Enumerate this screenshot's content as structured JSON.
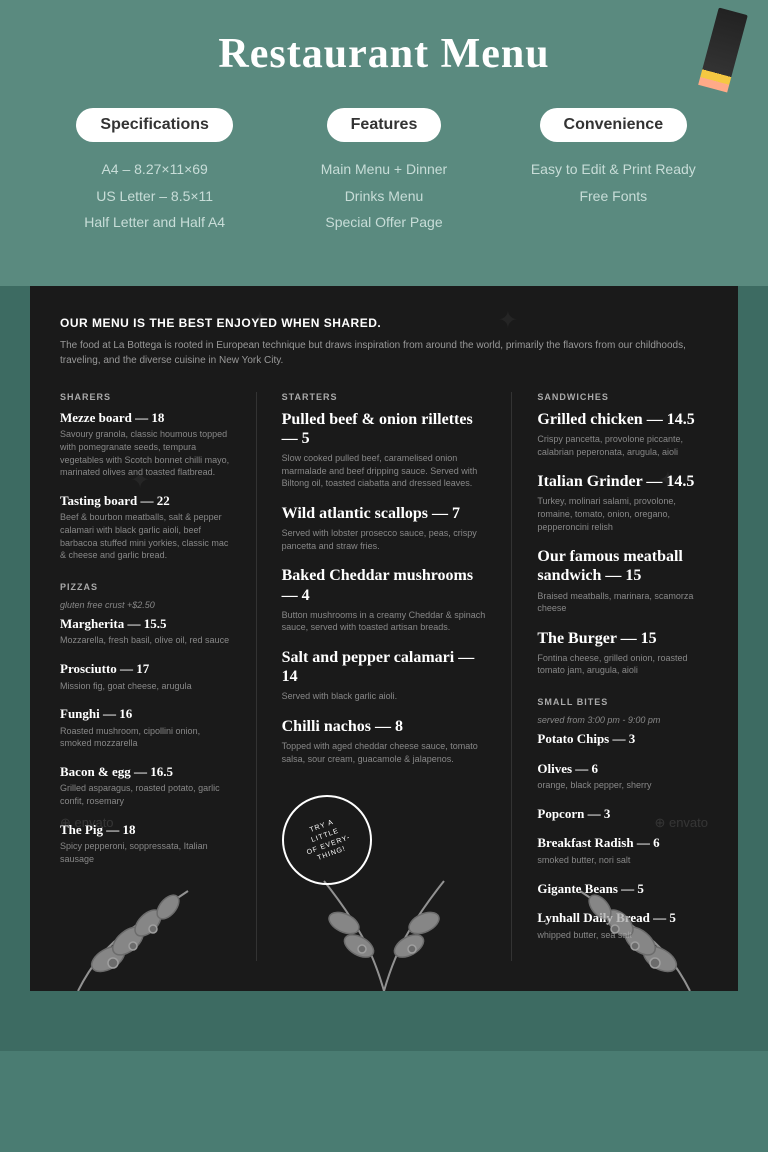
{
  "header": {
    "title": "Restaurant Menu"
  },
  "top": {
    "brown_strip_color": "#8B5E3C"
  },
  "specifications": {
    "label": "Specifications",
    "items": [
      "A4 – 8.27×11×69",
      "US Letter – 8.5×11",
      "Half Letter and Half A4"
    ]
  },
  "features": {
    "label": "Features",
    "items": [
      "Main Menu + Dinner",
      "Drinks Menu",
      "Special Offer Page"
    ]
  },
  "convenience": {
    "label": "Convenience",
    "items": [
      "Easy to Edit & Print Ready",
      "Free Fonts"
    ]
  },
  "menu": {
    "intro_title": "OUR MENU IS THE BEST ENJOYED WHEN SHARED.",
    "intro_text": "The food at La Bottega is rooted in European technique but draws inspiration from around the world, primarily the flavors from our childhoods, traveling, and the diverse cuisine in New York City.",
    "sharers": {
      "label": "SHARERS",
      "items": [
        {
          "name": "Mezze board — 18",
          "desc": "Savoury granola, classic houmous topped with pomegranate seeds, tempura vegetables with Scotch bonnet chilli mayo, marinated olives and toasted flatbread."
        },
        {
          "name": "Tasting board — 22",
          "desc": "Beef & bourbon meatballs, salt & pepper calamari with black garlic aioli, beef barbacoa stuffed mini yorkies, classic mac & cheese and garlic bread."
        }
      ]
    },
    "pizzas": {
      "label": "PIZZAS",
      "note": "gluten free crust +$2.50",
      "items": [
        {
          "name": "Margherita — 15.5",
          "desc": "Mozzarella, fresh basil, olive oil, red sauce"
        },
        {
          "name": "Prosciutto — 17",
          "desc": "Mission fig, goat cheese, arugula"
        },
        {
          "name": "Funghi — 16",
          "desc": "Roasted mushroom, cipollini onion, smoked mozzarella"
        },
        {
          "name": "Bacon & egg — 16.5",
          "desc": "Grilled asparagus, roasted potato, garlic confit, rosemary"
        },
        {
          "name": "The Pig — 18",
          "desc": "Spicy pepperoni, soppressata, Italian sausage"
        }
      ]
    },
    "starters": {
      "label": "STARTERS",
      "items": [
        {
          "name": "Pulled beef & onion rillettes — 5",
          "desc": "Slow cooked pulled beef, caramelised onion marmalade and beef dripping sauce. Served with Biltong oil, toasted ciabatta and dressed leaves."
        },
        {
          "name": "Wild atlantic scallops — 7",
          "desc": "Served with lobster prosecco sauce, peas, crispy pancetta and straw fries."
        },
        {
          "name": "Baked Cheddar mushrooms — 4",
          "desc": "Button mushrooms in a creamy Cheddar & spinach sauce, served with toasted artisan breads."
        },
        {
          "name": "Salt and pepper calamari — 14",
          "desc": "Served with black garlic aioli."
        },
        {
          "name": "Chilli nachos — 8",
          "desc": "Topped with aged cheddar cheese sauce, tomato salsa, sour cream, guacamole & jalapenos."
        }
      ]
    },
    "sandwiches": {
      "label": "SANDWICHES",
      "items": [
        {
          "name": "Grilled chicken — 14.5",
          "desc": "Crispy pancetta, provolone piccante, calabrian peperonata, arugula, aioli"
        },
        {
          "name": "Italian Grinder — 14.5",
          "desc": "Turkey, molinari salami, provolone, romaine, tomato, onion, oregano, pepperoncini relish"
        },
        {
          "name": "Our famous meatball sandwich — 15",
          "desc": "Braised meatballs, marinara, scamorza cheese"
        },
        {
          "name": "The Burger — 15",
          "desc": "Fontina cheese, grilled onion, roasted tomato jam, arugula, aioli"
        }
      ]
    },
    "small_bites": {
      "label": "SMALL BITES",
      "note": "served from 3:00 pm - 9:00 pm",
      "items": [
        {
          "name": "Potato Chips — 3",
          "desc": ""
        },
        {
          "name": "Olives — 6",
          "desc": "orange, black pepper, sherry"
        },
        {
          "name": "Popcorn — 3",
          "desc": ""
        },
        {
          "name": "Breakfast Radish — 6",
          "desc": "smoked butter, nori salt"
        },
        {
          "name": "Gigante Beans — 5",
          "desc": ""
        },
        {
          "name": "Lynhall Daily Bread — 5",
          "desc": "whipped butter, sea salt"
        }
      ]
    },
    "circle_badge": "TRY A LITTLE OF EVERYTHING!"
  }
}
